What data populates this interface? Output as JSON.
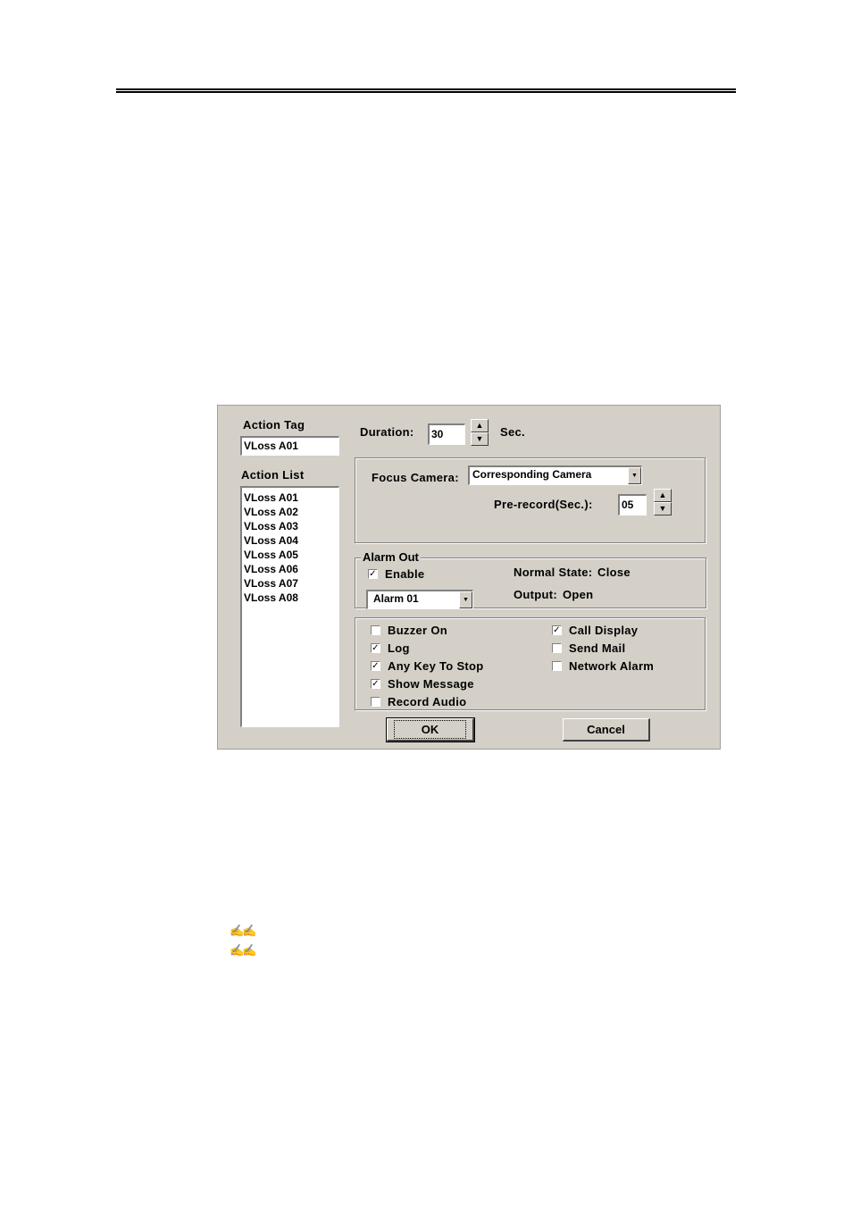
{
  "dialog": {
    "action_tag": {
      "label": "Action Tag",
      "value": "VLoss A01"
    },
    "action_list": {
      "label": "Action List",
      "items": [
        "VLoss A01",
        "VLoss A02",
        "VLoss A03",
        "VLoss A04",
        "VLoss A05",
        "VLoss A06",
        "VLoss A07",
        "VLoss A08"
      ]
    },
    "duration": {
      "label": "Duration:",
      "value": "30",
      "unit": "Sec."
    },
    "focus_camera": {
      "label": "Focus Camera:",
      "selected": "Corresponding Camera",
      "prerecord_label": "Pre-record(Sec.):",
      "prerecord_value": "05"
    },
    "alarm_out": {
      "title": "Alarm Out",
      "enable_label": "Enable",
      "enable_checked": true,
      "selected": "Alarm 01",
      "normal_state_label": "Normal State:",
      "normal_state_value": "Close",
      "output_label": "Output:",
      "output_value": "Open"
    },
    "options_left": [
      {
        "label": "Buzzer On",
        "checked": false
      },
      {
        "label": "Log",
        "checked": true
      },
      {
        "label": "Any Key To Stop",
        "checked": true
      },
      {
        "label": "Show Message",
        "checked": true
      },
      {
        "label": "Record Audio",
        "checked": false
      }
    ],
    "options_right": [
      {
        "label": "Call Display",
        "checked": true
      },
      {
        "label": "Send Mail",
        "checked": false
      },
      {
        "label": "Network Alarm",
        "checked": false
      }
    ],
    "ok_label": "OK",
    "cancel_label": "Cancel",
    "check_glyph": "✓",
    "spin_up_glyph": "▲",
    "spin_down_glyph": "▼",
    "combo_arrow_glyph": "▼"
  },
  "page": {
    "note_icon_glyph": "✍✍"
  }
}
